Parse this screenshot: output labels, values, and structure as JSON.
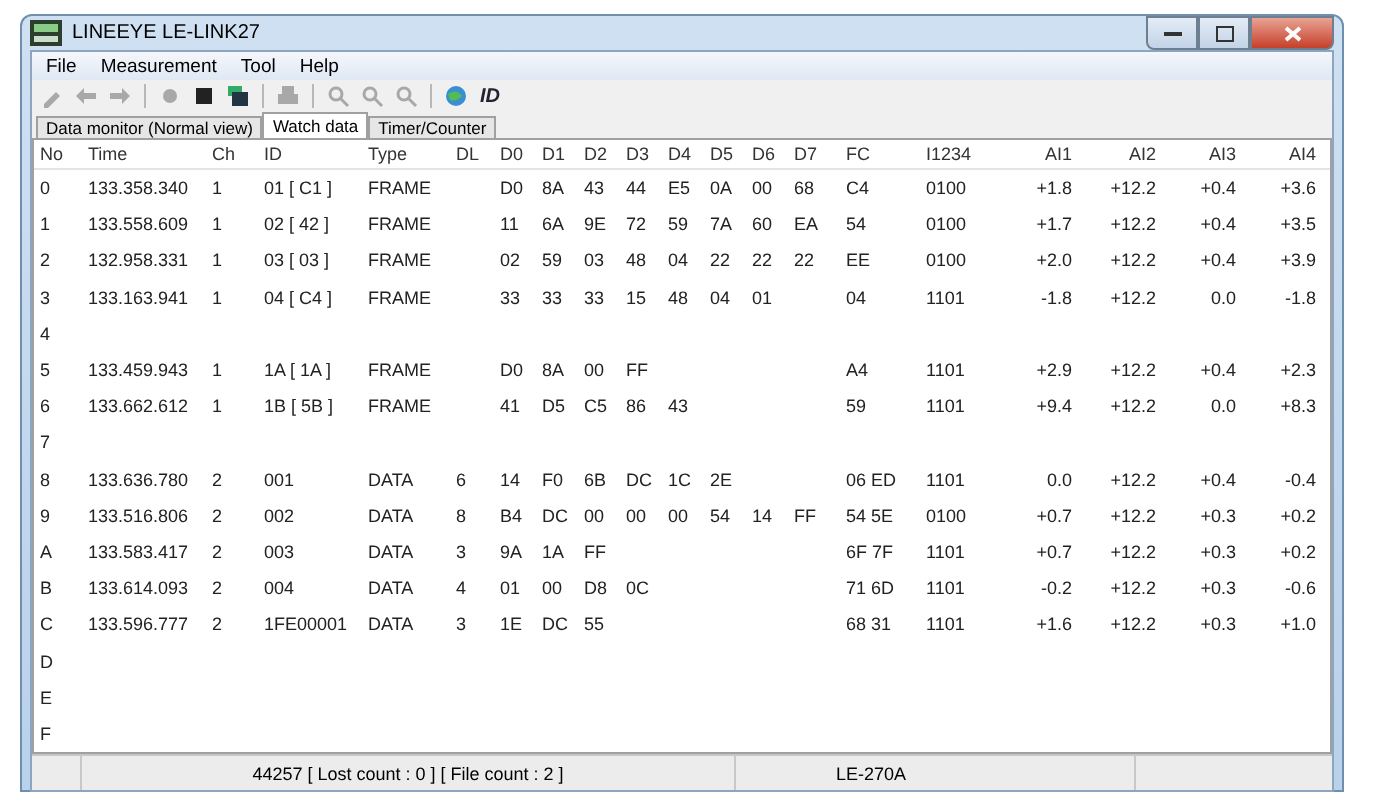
{
  "window": {
    "title": "LINEEYE LE-LINK27"
  },
  "menu": [
    "File",
    "Measurement",
    "Tool",
    "Help"
  ],
  "toolbar": [
    {
      "kind": "edit",
      "disabled": true
    },
    {
      "kind": "back",
      "disabled": true
    },
    {
      "kind": "forward",
      "disabled": true
    },
    {
      "kind": "sep"
    },
    {
      "kind": "record",
      "disabled": true
    },
    {
      "kind": "stop",
      "disabled": false
    },
    {
      "kind": "stack",
      "disabled": false
    },
    {
      "kind": "sep"
    },
    {
      "kind": "print",
      "disabled": true
    },
    {
      "kind": "sep"
    },
    {
      "kind": "zoom",
      "disabled": true
    },
    {
      "kind": "zoom-prev",
      "disabled": true
    },
    {
      "kind": "zoom-next",
      "disabled": true
    },
    {
      "kind": "sep"
    },
    {
      "kind": "globe",
      "disabled": false
    },
    {
      "kind": "text",
      "label": "ID",
      "disabled": false
    }
  ],
  "tabs": [
    {
      "label": "Data monitor (Normal view)",
      "selected": false
    },
    {
      "label": "Watch data",
      "selected": true
    },
    {
      "label": "Timer/Counter",
      "selected": false
    }
  ],
  "table": {
    "columns": [
      "No",
      "Time",
      "Ch",
      "ID",
      "Type",
      "DL",
      "D0",
      "D1",
      "D2",
      "D3",
      "D4",
      "D5",
      "D6",
      "D7",
      "FC",
      "I1234",
      "AI1",
      "AI2",
      "AI3",
      "AI4"
    ],
    "rows": [
      [
        "0",
        "133.358.340",
        "1",
        "01 [ C1 ]",
        "FRAME",
        null,
        "D0",
        "8A",
        "43",
        "44",
        "E5",
        "0A",
        "00",
        "68",
        "C4",
        "0100",
        "+1.8",
        "+12.2",
        "+0.4",
        "+3.6"
      ],
      [
        "1",
        "133.558.609",
        "1",
        "02 [ 42 ]",
        "FRAME",
        null,
        "11",
        "6A",
        "9E",
        "72",
        "59",
        "7A",
        "60",
        "EA",
        "54",
        "0100",
        "+1.7",
        "+12.2",
        "+0.4",
        "+3.5"
      ],
      [
        "2",
        "132.958.331",
        "1",
        "03 [ 03 ]",
        "FRAME",
        null,
        "02",
        "59",
        "03",
        "48",
        "04",
        "22",
        "22",
        "22",
        "EE",
        "0100",
        "+2.0",
        "+12.2",
        "+0.4",
        "+3.9"
      ],
      [
        "3",
        "133.163.941",
        "1",
        "04 [ C4 ]",
        "FRAME",
        null,
        "33",
        "33",
        "33",
        "15",
        "48",
        "04",
        "01",
        null,
        "04",
        "1101",
        "-1.8",
        "+12.2",
        "0.0",
        "-1.8"
      ],
      [
        "4"
      ],
      [
        "5",
        "133.459.943",
        "1",
        "1A [ 1A ]",
        "FRAME",
        null,
        "D0",
        "8A",
        "00",
        "FF",
        null,
        null,
        null,
        null,
        "A4",
        "1101",
        "+2.9",
        "+12.2",
        "+0.4",
        "+2.3"
      ],
      [
        "6",
        "133.662.612",
        "1",
        "1B [ 5B ]",
        "FRAME",
        null,
        "41",
        "D5",
        "C5",
        "86",
        "43",
        null,
        null,
        null,
        "59",
        "1101",
        "+9.4",
        "+12.2",
        "0.0",
        "+8.3"
      ],
      [
        "7"
      ],
      [
        "8",
        "133.636.780",
        "2",
        "001",
        "DATA",
        "6",
        "14",
        "F0",
        "6B",
        "DC",
        "1C",
        "2E",
        null,
        null,
        "06 ED",
        "1101",
        "0.0",
        "+12.2",
        "+0.4",
        "-0.4"
      ],
      [
        "9",
        "133.516.806",
        "2",
        "002",
        "DATA",
        "8",
        "B4",
        "DC",
        "00",
        "00",
        "00",
        "54",
        "14",
        "FF",
        "54 5E",
        "0100",
        "+0.7",
        "+12.2",
        "+0.3",
        "+0.2"
      ],
      [
        "A",
        "133.583.417",
        "2",
        "003",
        "DATA",
        "3",
        "9A",
        "1A",
        "FF",
        null,
        null,
        null,
        null,
        null,
        "6F 7F",
        "1101",
        "+0.7",
        "+12.2",
        "+0.3",
        "+0.2"
      ],
      [
        "B",
        "133.614.093",
        "2",
        "004",
        "DATA",
        "4",
        "01",
        "00",
        "D8",
        "0C",
        null,
        null,
        null,
        null,
        "71 6D",
        "1101",
        "-0.2",
        "+12.2",
        "+0.3",
        "-0.6"
      ],
      [
        "C",
        "133.596.777",
        "2",
        "1FE00001",
        "DATA",
        "3",
        "1E",
        "DC",
        "55",
        null,
        null,
        null,
        null,
        null,
        "68 31",
        "1101",
        "+1.6",
        "+12.2",
        "+0.3",
        "+1.0"
      ],
      [
        "D"
      ],
      [
        "E"
      ],
      [
        "F"
      ]
    ]
  },
  "status_bar": {
    "sections": [
      "44257 [ Lost count : 0 ] [ File count : 2 ]",
      "LE-270A"
    ]
  }
}
